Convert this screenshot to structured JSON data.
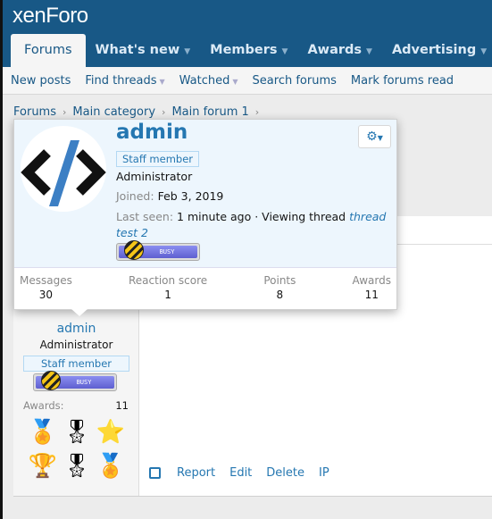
{
  "header": {
    "logo": "xenForo",
    "tabs": [
      {
        "label": "Forums",
        "active": true
      },
      {
        "label": "What's new"
      },
      {
        "label": "Members"
      },
      {
        "label": "Awards"
      },
      {
        "label": "Advertising"
      }
    ]
  },
  "subnav": [
    "New posts",
    "Find threads",
    "Watched",
    "Search forums",
    "Mark forums read"
  ],
  "breadcrumb": [
    "Forums",
    "Main category",
    "Main forum 1"
  ],
  "popup": {
    "username": "admin",
    "badge": "Staff member",
    "role": "Administrator",
    "joined_label": "Joined:",
    "joined": "Feb 3, 2019",
    "last_seen_label": "Last seen:",
    "last_seen": "1 minute ago · Viewing thread",
    "thread_link": "thread test 2",
    "status": "BUSY",
    "stats": [
      {
        "label": "Messages",
        "value": "30"
      },
      {
        "label": "Reaction score",
        "value": "1"
      },
      {
        "label": "Points",
        "value": "8"
      },
      {
        "label": "Awards",
        "value": "11"
      }
    ]
  },
  "post": {
    "username": "admin",
    "role": "Administrator",
    "badge": "Staff member",
    "status": "BUSY",
    "awards_label": "Awards:",
    "awards_count": "11",
    "medals": [
      "🏅",
      "🎖",
      "⭐",
      "🏆",
      "🎖",
      "🏅"
    ],
    "actions": [
      "Report",
      "Edit",
      "Delete",
      "IP"
    ]
  },
  "colors": {
    "header": "#185886",
    "link": "#2577b1",
    "popup_bg": "#edf6fd"
  }
}
